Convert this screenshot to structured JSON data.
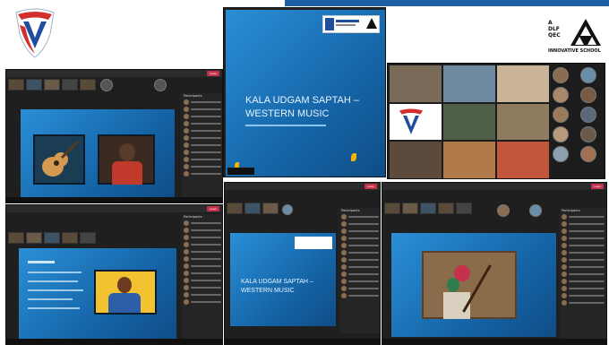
{
  "school_top_right_logo": {
    "line1": "A",
    "line2": "DLF",
    "line3": "QEC",
    "line4": "INNOVATIVE SCHOOL"
  },
  "main_slide": {
    "title": "KALA UDGAM SAPTAH –\nWESTERN MUSIC"
  },
  "bottom_middle_slide": {
    "title": "KALA UDGAM SAPTAH –\nWESTERN MUSIC"
  },
  "teams": {
    "leave_label": "Leave",
    "participants_header": "Participants"
  },
  "colors": {
    "slide_blue": "#1e7bc4",
    "top_banner": "#1f5fa8",
    "leave_red": "#c4314b",
    "logo_red": "#d32f2f",
    "logo_blue": "#1f4e9c"
  },
  "icons": [
    "school-shield-logo",
    "triangle-school-logo",
    "guitar-image",
    "person-avatar"
  ]
}
